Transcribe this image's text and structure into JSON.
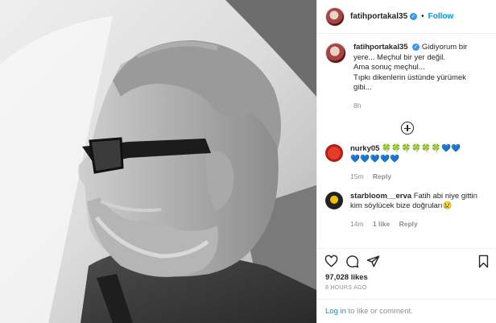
{
  "post": {
    "username": "fatihportakal35",
    "follow_label": "Follow",
    "separator": "•",
    "caption_lines": [
      "Gidiyorum bir",
      "yere... Meçhul bir yer değil.",
      "Ama sonuç meçhul...",
      "Tıpkı dikenlerin üstünde yürümek",
      "gibi..."
    ],
    "caption_time": "8h"
  },
  "comments": [
    {
      "username": "nurky05",
      "text_line1": "🍀🍀🍀🍀🍀🍀💙💙",
      "text_line2": "💙💙💙💙💙",
      "time": "15m",
      "reply_label": "Reply"
    },
    {
      "username": "starbloom__erva",
      "text_line1": "Fatih abi niye gittin",
      "text_line2": "kim söylücek bize doğruları😢",
      "time": "14m",
      "likes": "1 like",
      "reply_label": "Reply"
    }
  ],
  "actions": {
    "likes_count": "97,028 likes",
    "posted_ago": "8 HOURS AGO",
    "login_link": "Log in",
    "login_rest": " to like or comment."
  },
  "icons": [
    "verified-badge-icon",
    "add-comment-icon",
    "heart-icon",
    "comment-icon",
    "share-icon",
    "bookmark-icon"
  ],
  "colors": {
    "accent": "#0095f6",
    "muted": "#8e8e8e",
    "text": "#262626",
    "verified": "#3897f0"
  }
}
